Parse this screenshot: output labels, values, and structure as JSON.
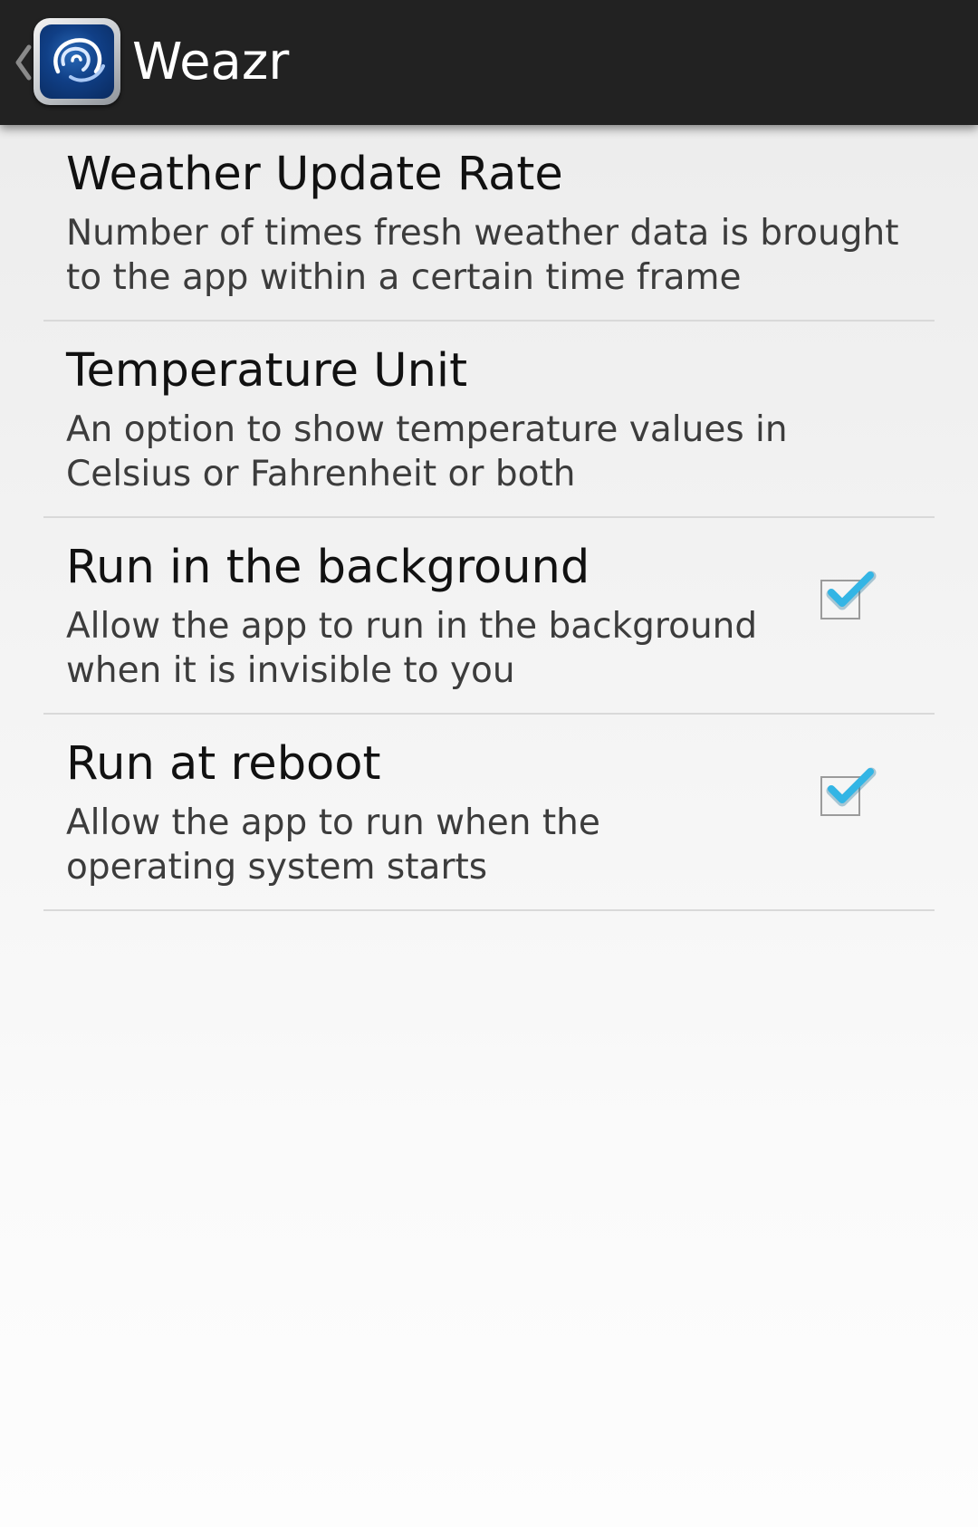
{
  "action_bar": {
    "title": "Weazr"
  },
  "preferences": [
    {
      "title": "Weather Update Rate",
      "summary": "Number of times fresh weather data is brought to the app within a certain time frame"
    },
    {
      "title": "Temperature Unit",
      "summary": "An option to show temperature values in Celsius or Fahrenheit or both"
    },
    {
      "title": "Run in the background",
      "summary": "Allow the app to run in the background when it is invisible to you",
      "checked": true
    },
    {
      "title": "Run at reboot",
      "summary": "Allow the app to run when the operating system starts",
      "checked": true
    }
  ],
  "colors": {
    "action_bar_bg": "#222222",
    "checkmark": "#33b5e5"
  }
}
